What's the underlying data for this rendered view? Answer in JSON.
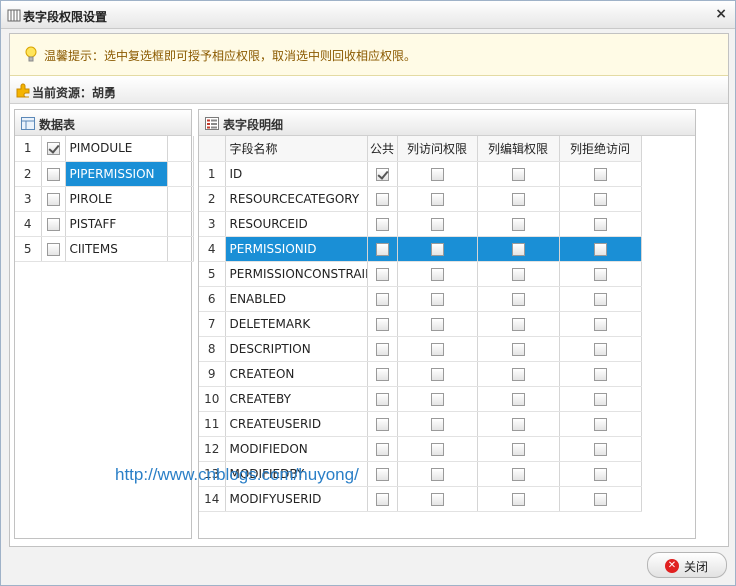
{
  "window": {
    "title": "表字段权限设置",
    "close_glyph": "×"
  },
  "tip": {
    "text": "温馨提示：选中复选框即可授予相应权限，取消选中则回收相应权限。"
  },
  "resource": {
    "label": "当前资源：胡勇"
  },
  "left_panel": {
    "title": "数据表",
    "rows": [
      {
        "num": "1",
        "name": "PIMODULE",
        "checked": true,
        "selected": false
      },
      {
        "num": "2",
        "name": "PIPERMISSION",
        "checked": false,
        "selected": true
      },
      {
        "num": "3",
        "name": "PIROLE",
        "checked": false,
        "selected": false
      },
      {
        "num": "4",
        "name": "PISTAFF",
        "checked": false,
        "selected": false
      },
      {
        "num": "5",
        "name": "CIITEMS",
        "checked": false,
        "selected": false
      }
    ]
  },
  "right_panel": {
    "title": "表字段明细",
    "columns": [
      "字段名称",
      "公共",
      "列访问权限",
      "列编辑权限",
      "列拒绝访问"
    ],
    "rows": [
      {
        "num": "1",
        "name": "ID",
        "public": true,
        "selected": false
      },
      {
        "num": "2",
        "name": "RESOURCECATEGORY",
        "public": false,
        "selected": false
      },
      {
        "num": "3",
        "name": "RESOURCEID",
        "public": false,
        "selected": false
      },
      {
        "num": "4",
        "name": "PERMISSIONID",
        "public": false,
        "selected": true
      },
      {
        "num": "5",
        "name": "PERMISSIONCONSTRAINT",
        "public": false,
        "selected": false
      },
      {
        "num": "6",
        "name": "ENABLED",
        "public": false,
        "selected": false
      },
      {
        "num": "7",
        "name": "DELETEMARK",
        "public": false,
        "selected": false
      },
      {
        "num": "8",
        "name": "DESCRIPTION",
        "public": false,
        "selected": false
      },
      {
        "num": "9",
        "name": "CREATEON",
        "public": false,
        "selected": false
      },
      {
        "num": "10",
        "name": "CREATEBY",
        "public": false,
        "selected": false
      },
      {
        "num": "11",
        "name": "CREATEUSERID",
        "public": false,
        "selected": false
      },
      {
        "num": "12",
        "name": "MODIFIEDON",
        "public": false,
        "selected": false
      },
      {
        "num": "13",
        "name": "MODIFIEDBY",
        "public": false,
        "selected": false
      },
      {
        "num": "14",
        "name": "MODIFYUSERID",
        "public": false,
        "selected": false
      }
    ]
  },
  "watermark": "http://www.cnblogs.com/huyong/",
  "footer": {
    "close_label": "关闭",
    "close_glyph": "✕"
  },
  "colors": {
    "selection": "#1a8fd6",
    "tip_text": "#8b5a00",
    "watermark": "#2a7fc7"
  }
}
